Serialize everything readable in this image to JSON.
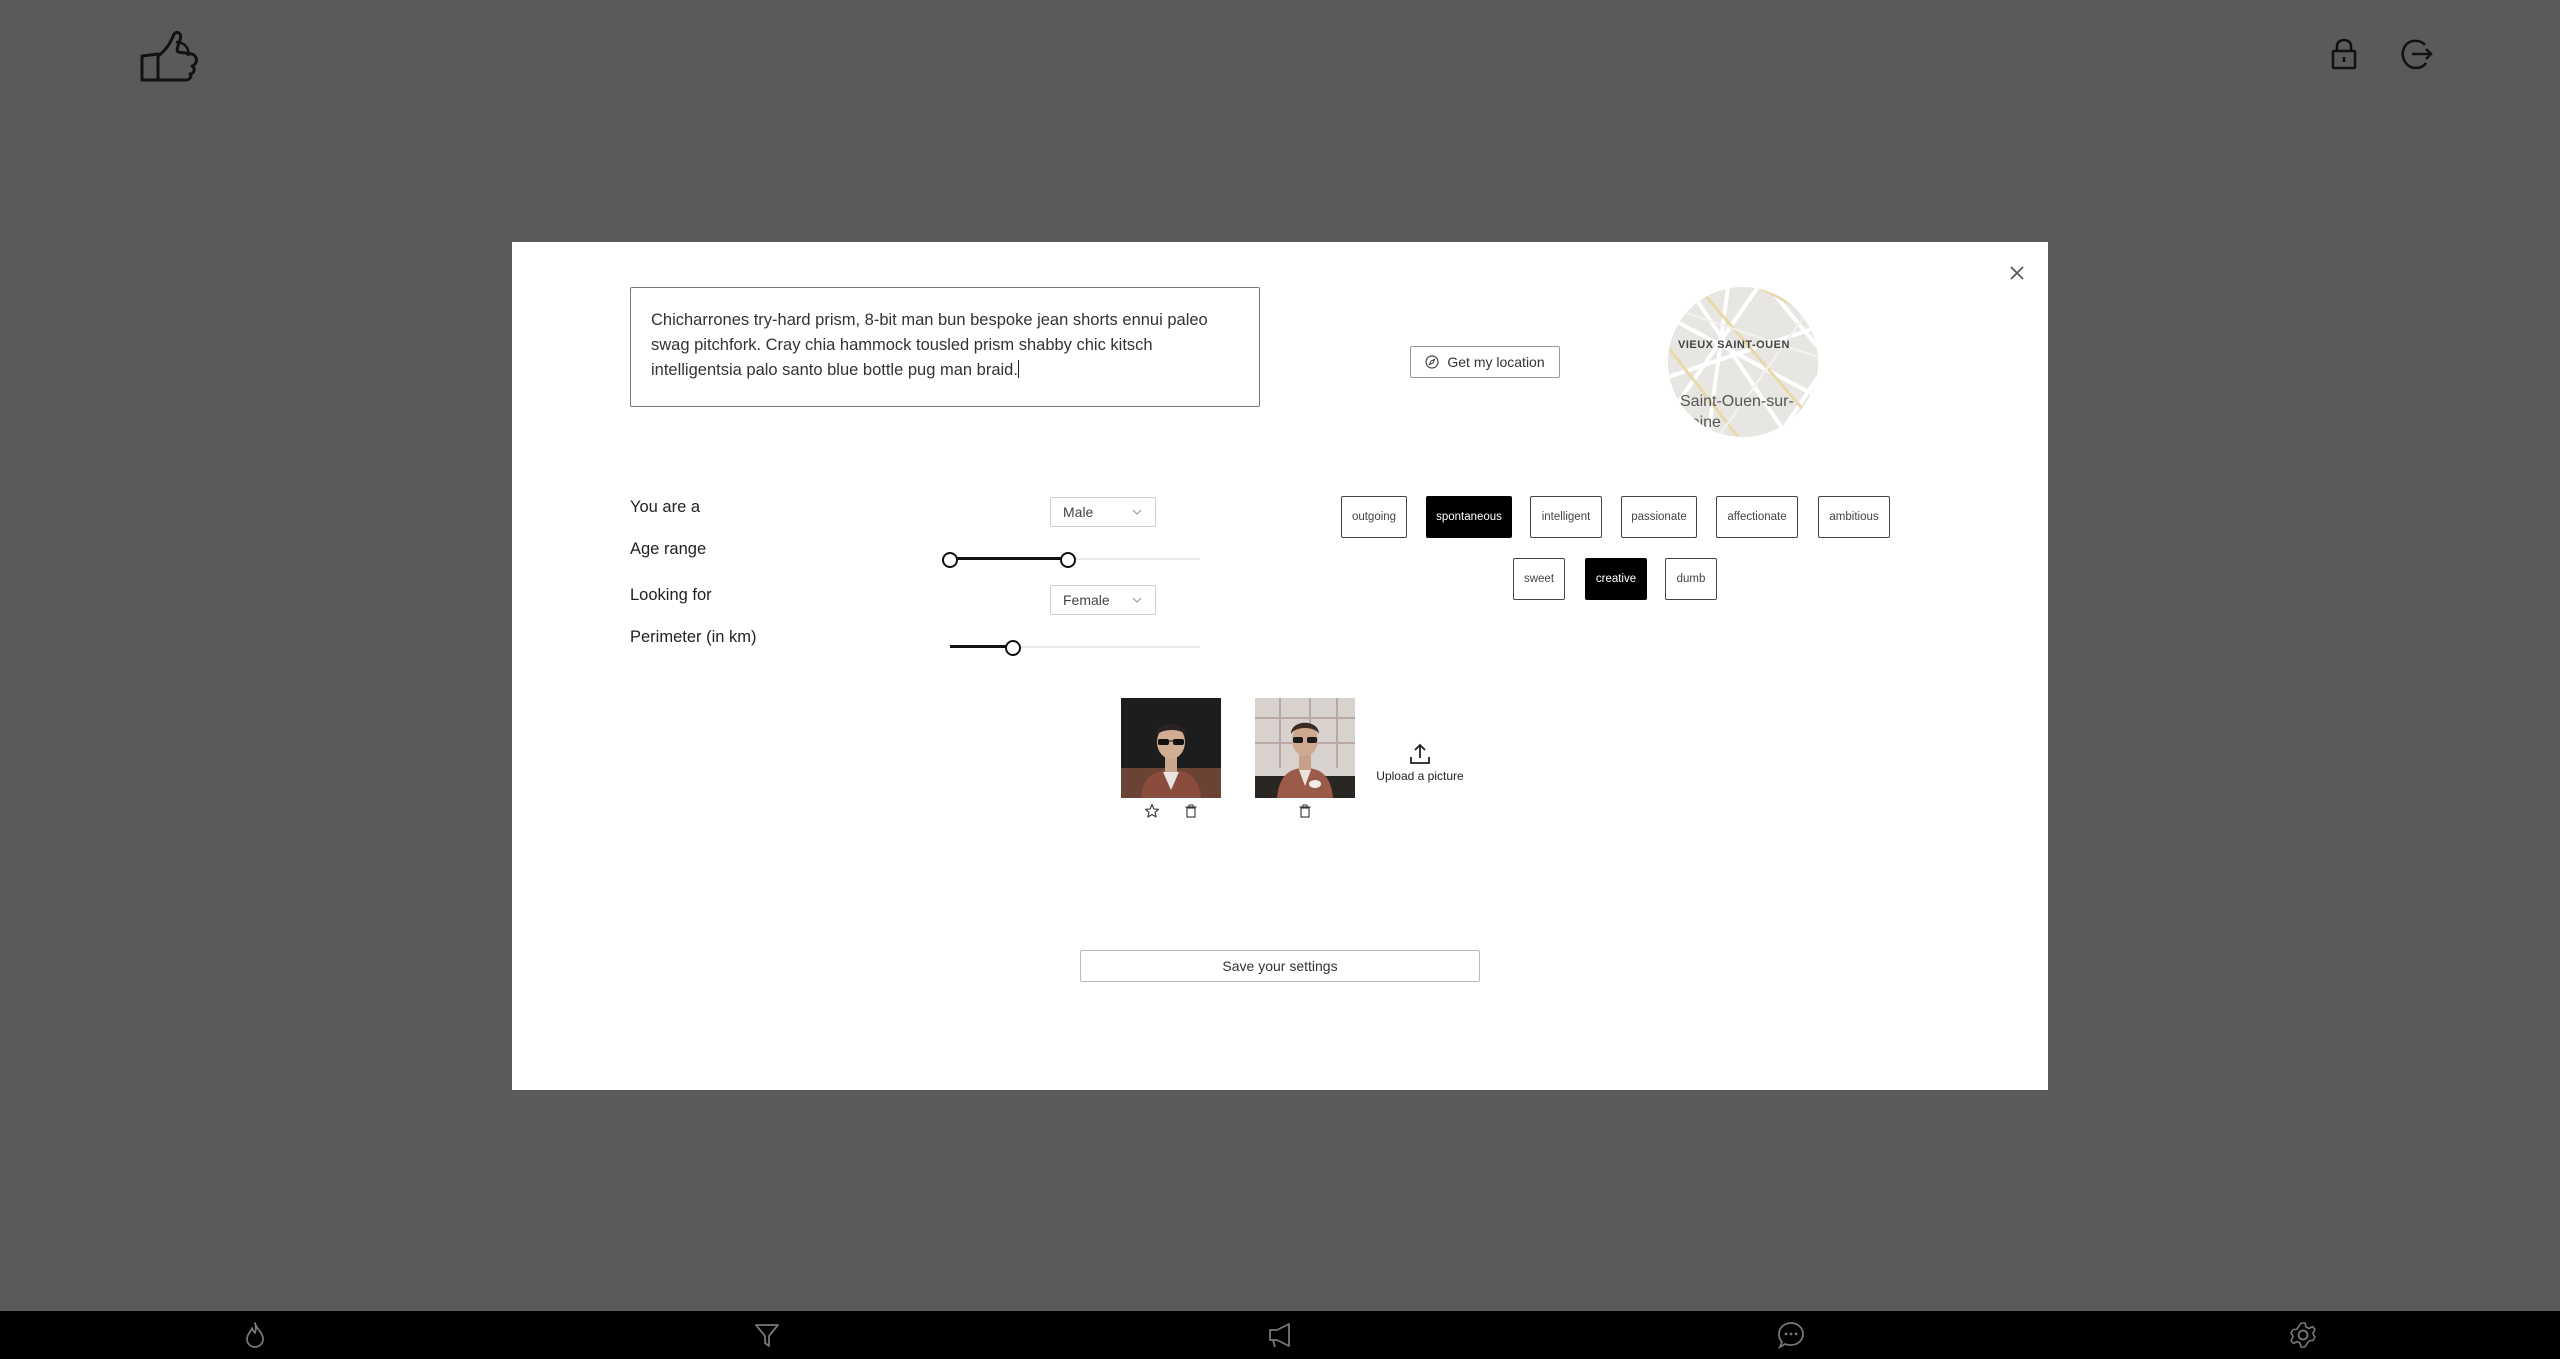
{
  "app": {
    "logo_icon": "thumbs-up-hand-icon",
    "header_icons": [
      "lock-icon",
      "logout-icon"
    ]
  },
  "bottom_nav": {
    "items": [
      "flame-icon",
      "filter-icon",
      "megaphone-icon",
      "chat-icon",
      "gear-icon"
    ]
  },
  "modal": {
    "close_icon": "close-icon",
    "bio": {
      "value": "Chicharrones try-hard prism, 8-bit man bun bespoke jean shorts ennui paleo swag pitchfork. Cray chia hammock tousled prism shabby chic kitsch intelligentsia palo santo blue bottle pug man braid."
    },
    "location": {
      "button_label": "Get my location",
      "map_area_label": "VIEUX SAINT-OUEN",
      "map_city_label": "Saint-Ouen-sur-Seine"
    },
    "form": {
      "gender_label": "You are a",
      "gender_value": "Male",
      "age_label": "Age range",
      "age_range": {
        "low_fraction": 0.0,
        "high_fraction": 0.47
      },
      "looking_label": "Looking for",
      "looking_value": "Female",
      "perimeter_label": "Perimeter (in km)",
      "perimeter": {
        "fraction": 0.25
      }
    },
    "tags": [
      {
        "label": "outgoing",
        "selected": false
      },
      {
        "label": "spontaneous",
        "selected": true
      },
      {
        "label": "intelligent",
        "selected": false
      },
      {
        "label": "passionate",
        "selected": false
      },
      {
        "label": "affectionate",
        "selected": false
      },
      {
        "label": "ambitious",
        "selected": false
      },
      {
        "label": "sweet",
        "selected": false
      },
      {
        "label": "creative",
        "selected": true
      },
      {
        "label": "dumb",
        "selected": false
      }
    ],
    "pictures": {
      "upload_label": "Upload a picture",
      "upload_icon": "upload-icon",
      "actions": [
        "star-icon",
        "trash-icon"
      ]
    },
    "save_label": "Save your settings"
  },
  "colors": {
    "overlay": "#5a5a5a",
    "modal_bg": "#ffffff",
    "accent": "#000000",
    "bottom_bar": "#000000"
  }
}
